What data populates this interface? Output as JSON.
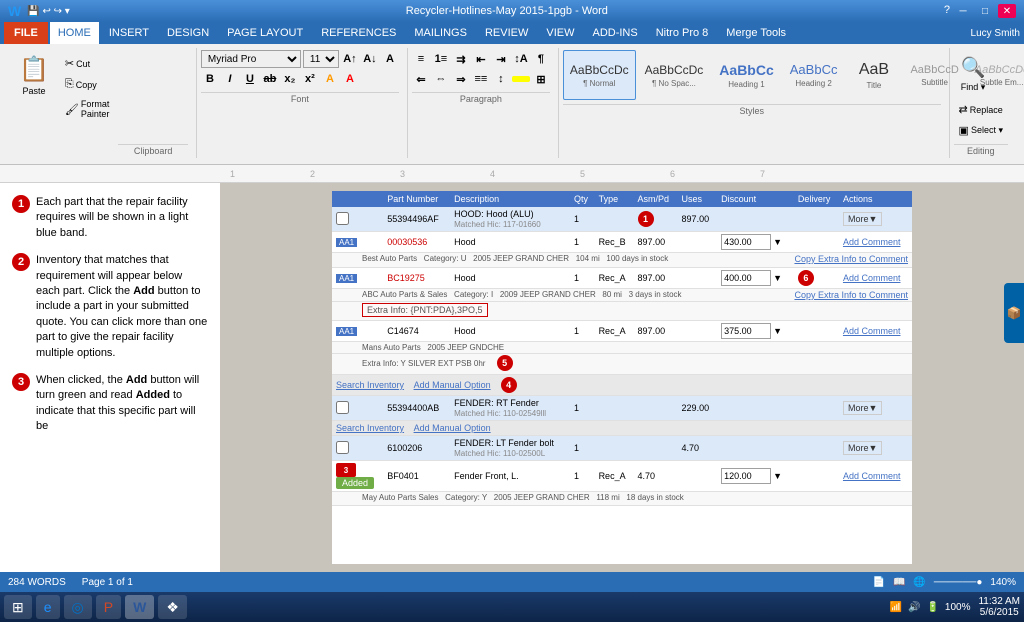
{
  "titleBar": {
    "title": "Recycler-Hotlines-May 2015-1pgb - Word",
    "appIcon": "W",
    "user": "Lucy Smith",
    "winButtons": [
      "─",
      "□",
      "✕"
    ]
  },
  "menuBar": {
    "items": [
      "FILE",
      "HOME",
      "INSERT",
      "DESIGN",
      "PAGE LAYOUT",
      "REFERENCES",
      "MAILINGS",
      "REVIEW",
      "VIEW",
      "ADD-INS",
      "Nitro Pro 8",
      "Merge Tools"
    ],
    "active": "HOME"
  },
  "ribbon": {
    "clipboard": {
      "label": "Clipboard",
      "paste": "Paste",
      "cut": "Cut",
      "copy": "Copy",
      "formatPainter": "Format Painter"
    },
    "font": {
      "label": "Font",
      "name": "Myriad Pro",
      "size": "11",
      "bold": "B",
      "italic": "I",
      "underline": "U",
      "strikethrough": "ab",
      "subscript": "x₂",
      "superscript": "x²"
    },
    "paragraph": {
      "label": "Paragraph"
    },
    "styles": {
      "label": "Styles",
      "items": [
        {
          "id": "normal",
          "preview": "AaBbCcDc",
          "label": "¶ Normal"
        },
        {
          "id": "noSpac",
          "preview": "AaBbCcDc",
          "label": "¶ No Spac..."
        },
        {
          "id": "heading1",
          "preview": "AaBbCc",
          "label": "Heading 1"
        },
        {
          "id": "heading2",
          "preview": "AaBbCc",
          "label": "Heading 2"
        },
        {
          "id": "title",
          "preview": "AaB",
          "label": "Title"
        },
        {
          "id": "subtitle",
          "preview": "AaBbCcD",
          "label": "Subtitle"
        },
        {
          "id": "subtleEm",
          "preview": "AaBbCcDc",
          "label": "Subtle Em..."
        }
      ]
    },
    "editing": {
      "label": "Editing",
      "find": "Find ▾",
      "replace": "Replace",
      "select": "Select ▾"
    }
  },
  "annotations": [
    {
      "num": "1",
      "text": "Each part that the repair facility requires will be shown in a light blue band."
    },
    {
      "num": "2",
      "text": "Inventory that matches that requirement will appear below each part. Click the Add button to include a part in your submitted quote. You can click more than one part to give the repair facility multiple options."
    },
    {
      "num": "3",
      "text": "When clicked, the Add button will turn green and read Added to indicate that this specific part will be"
    }
  ],
  "tableHeader": {
    "cols": [
      "",
      "Part Number",
      "Description",
      "Qty",
      "Type",
      "Asm/Pd",
      "Uses",
      "Discount",
      "Delivery",
      "Actions"
    ]
  },
  "tableRows": [
    {
      "type": "highlight",
      "id": "55394496AF",
      "desc": "HOOD: Hood (ALU)\nMatched Hic: 117-01660",
      "qty": "1",
      "numBadge": "1",
      "price": "897.00",
      "action": "More▼"
    },
    {
      "type": "sub",
      "label": "AA1",
      "id": "00030536",
      "desc": "Hood",
      "qty": "1",
      "recType": "Rec_B",
      "price1": "897.00",
      "price2": "430.00",
      "action": "Add Comment",
      "extra": "Best Auto Parts   Category: U   2005 JEEP GRAND CHER   104 mi   100 days in stock"
    },
    {
      "type": "sub2",
      "label": "AA1",
      "id": "BC19275",
      "desc": "Hood",
      "qty": "1",
      "recType": "Rec_A",
      "price1": "897.00",
      "price2": "400.00",
      "numBadge": "6",
      "action": "Add Comment",
      "shopInfo": "ABC Auto Parts & Sales   Category: I   2009 JEEP GRAND CHER   80 mi   3 days in stock",
      "extraInfo": "Extra Info: {PNT:PDA},3PO,5"
    },
    {
      "type": "sub3",
      "label": "AA1",
      "id": "C14674",
      "desc": "Hood",
      "qty": "1",
      "recType": "Rec_A",
      "price1": "897.00",
      "price2": "375.00",
      "action": "Add Comment",
      "shopInfo": "Mans Auto Parts   2005 JEEP GNDCHE",
      "extraInfo": "Extra Info: Y SILVER EXT PSB 0hr",
      "numBadge5": "5"
    },
    {
      "type": "section",
      "searchLink": "Search Inventory",
      "manualLink": "Add Manual Option",
      "numBadge": "4"
    },
    {
      "type": "highlight2",
      "id": "55394400AB",
      "desc": "FENDER: RT Fender\nMatched Hic: 110-02549lll",
      "qty": "1",
      "price": "229.00",
      "action": "More▼"
    },
    {
      "type": "section2",
      "searchLink": "Search Inventory",
      "manualLink": "Add Manual Option"
    },
    {
      "type": "highlight3",
      "id": "6100206",
      "desc": "FENDER: LT Fender bolt\nMatched Hic: 110-02500L",
      "qty": "1",
      "price": "4.70",
      "action": "More▼"
    },
    {
      "type": "added",
      "label": "Added",
      "id": "BF0401",
      "desc": "Fender Front, L.",
      "qty": "1",
      "recType": "Rec_A",
      "price1": "4.70",
      "price2": "120.00",
      "action": "Add Comment",
      "shopInfo": "May Auto Parts Sales   Category: Y   2005 JEEP GRAND CHER   118 mi   18 days in stock",
      "numBadge3": "3"
    }
  ],
  "statusBar": {
    "words": "284 WORDS",
    "page": "Page 1 of 1",
    "zoom": "140%"
  },
  "taskbar": {
    "buttons": [
      "⊞",
      "e",
      "◎",
      "P",
      "W",
      "❖"
    ],
    "time": "11:32 AM",
    "date": "5/6/2015",
    "battery": "100%"
  }
}
